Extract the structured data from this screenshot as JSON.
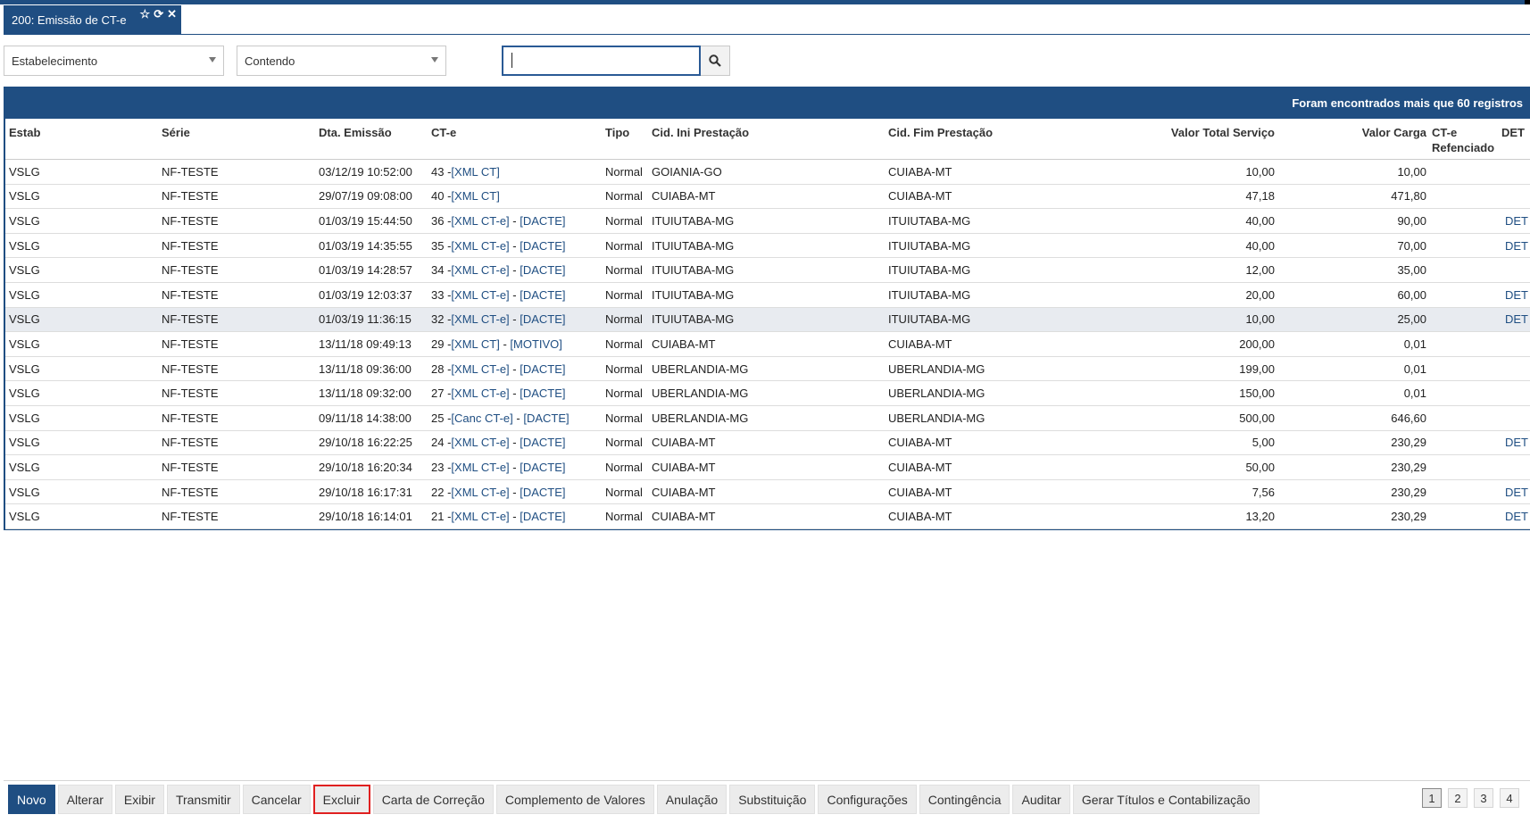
{
  "tab": {
    "title": "200: Emissão de CT-e",
    "icons": [
      "star-icon",
      "refresh-icon",
      "close-icon"
    ]
  },
  "filters": {
    "field_select": "Estabelecimento",
    "operator_select": "Contendo",
    "search_value": "",
    "search_icon": "search-icon"
  },
  "grid": {
    "banner": "Foram encontrados mais que 60 registros",
    "columns": {
      "estab": "Estab",
      "serie": "Série",
      "dta": "Dta. Emissão",
      "cte": "CT-e",
      "tipo": "Tipo",
      "ini": "Cid. Ini Prestação",
      "fim": "Cid. Fim Prestação",
      "vts": "Valor Total Serviço",
      "vc": "Valor Carga",
      "ref": "CT-e Refenciado",
      "det": "DET"
    },
    "rows": [
      {
        "estab": "VSLG",
        "serie": "NF-TESTE",
        "dta": "03/12/19 10:52:00",
        "num": "43 - ",
        "l1": "[XML CT]",
        "sep": "",
        "l2": "",
        "tipo": "Normal",
        "ini": "GOIANIA-GO",
        "fim": "CUIABA-MT",
        "vts": "10,00",
        "vc": "10,00",
        "det": ""
      },
      {
        "estab": "VSLG",
        "serie": "NF-TESTE",
        "dta": "29/07/19 09:08:00",
        "num": "40 - ",
        "l1": "[XML CT]",
        "sep": "",
        "l2": "",
        "tipo": "Normal",
        "ini": "CUIABA-MT",
        "fim": "CUIABA-MT",
        "vts": "47,18",
        "vc": "471,80",
        "det": ""
      },
      {
        "estab": "VSLG",
        "serie": "NF-TESTE",
        "dta": "01/03/19 15:44:50",
        "num": "36 - ",
        "l1": "[XML CT-e]",
        "sep": " - ",
        "l2": "[DACTE]",
        "tipo": "Normal",
        "ini": "ITUIUTABA-MG",
        "fim": "ITUIUTABA-MG",
        "vts": "40,00",
        "vc": "90,00",
        "det": "DET"
      },
      {
        "estab": "VSLG",
        "serie": "NF-TESTE",
        "dta": "01/03/19 14:35:55",
        "num": "35 - ",
        "l1": "[XML CT-e]",
        "sep": " - ",
        "l2": "[DACTE]",
        "tipo": "Normal",
        "ini": "ITUIUTABA-MG",
        "fim": "ITUIUTABA-MG",
        "vts": "40,00",
        "vc": "70,00",
        "det": "DET"
      },
      {
        "estab": "VSLG",
        "serie": "NF-TESTE",
        "dta": "01/03/19 14:28:57",
        "num": "34 - ",
        "l1": "[XML CT-e]",
        "sep": " - ",
        "l2": "[DACTE]",
        "tipo": "Normal",
        "ini": "ITUIUTABA-MG",
        "fim": "ITUIUTABA-MG",
        "vts": "12,00",
        "vc": "35,00",
        "det": ""
      },
      {
        "estab": "VSLG",
        "serie": "NF-TESTE",
        "dta": "01/03/19 12:03:37",
        "num": "33 - ",
        "l1": "[XML CT-e]",
        "sep": " - ",
        "l2": "[DACTE]",
        "tipo": "Normal",
        "ini": "ITUIUTABA-MG",
        "fim": "ITUIUTABA-MG",
        "vts": "20,00",
        "vc": "60,00",
        "det": "DET"
      },
      {
        "estab": "VSLG",
        "serie": "NF-TESTE",
        "dta": "01/03/19 11:36:15",
        "num": "32 - ",
        "l1": "[XML CT-e]",
        "sep": " - ",
        "l2": "[DACTE]",
        "tipo": "Normal",
        "ini": "ITUIUTABA-MG",
        "fim": "ITUIUTABA-MG",
        "vts": "10,00",
        "vc": "25,00",
        "det": "DET",
        "highlight": true
      },
      {
        "estab": "VSLG",
        "serie": "NF-TESTE",
        "dta": "13/11/18 09:49:13",
        "num": "29 - ",
        "l1": "[XML CT]",
        "sep": " - ",
        "l2": "[MOTIVO]",
        "tipo": "Normal",
        "ini": "CUIABA-MT",
        "fim": "CUIABA-MT",
        "vts": "200,00",
        "vc": "0,01",
        "det": ""
      },
      {
        "estab": "VSLG",
        "serie": "NF-TESTE",
        "dta": "13/11/18 09:36:00",
        "num": "28 - ",
        "l1": "[XML CT-e]",
        "sep": " - ",
        "l2": "[DACTE]",
        "tipo": "Normal",
        "ini": "UBERLANDIA-MG",
        "fim": "UBERLANDIA-MG",
        "vts": "199,00",
        "vc": "0,01",
        "det": ""
      },
      {
        "estab": "VSLG",
        "serie": "NF-TESTE",
        "dta": "13/11/18 09:32:00",
        "num": "27 - ",
        "l1": "[XML CT-e]",
        "sep": " - ",
        "l2": "[DACTE]",
        "tipo": "Normal",
        "ini": "UBERLANDIA-MG",
        "fim": "UBERLANDIA-MG",
        "vts": "150,00",
        "vc": "0,01",
        "det": ""
      },
      {
        "estab": "VSLG",
        "serie": "NF-TESTE",
        "dta": "09/11/18 14:38:00",
        "num": "25 - ",
        "l1": "[Canc CT-e]",
        "sep": " - ",
        "l2": "[DACTE]",
        "tipo": "Normal",
        "ini": "UBERLANDIA-MG",
        "fim": "UBERLANDIA-MG",
        "vts": "500,00",
        "vc": "646,60",
        "det": ""
      },
      {
        "estab": "VSLG",
        "serie": "NF-TESTE",
        "dta": "29/10/18 16:22:25",
        "num": "24 - ",
        "l1": "[XML CT-e]",
        "sep": " - ",
        "l2": "[DACTE]",
        "tipo": "Normal",
        "ini": "CUIABA-MT",
        "fim": "CUIABA-MT",
        "vts": "5,00",
        "vc": "230,29",
        "det": "DET"
      },
      {
        "estab": "VSLG",
        "serie": "NF-TESTE",
        "dta": "29/10/18 16:20:34",
        "num": "23 - ",
        "l1": "[XML CT-e]",
        "sep": " - ",
        "l2": "[DACTE]",
        "tipo": "Normal",
        "ini": "CUIABA-MT",
        "fim": "CUIABA-MT",
        "vts": "50,00",
        "vc": "230,29",
        "det": ""
      },
      {
        "estab": "VSLG",
        "serie": "NF-TESTE",
        "dta": "29/10/18 16:17:31",
        "num": "22 - ",
        "l1": "[XML CT-e]",
        "sep": " - ",
        "l2": "[DACTE]",
        "tipo": "Normal",
        "ini": "CUIABA-MT",
        "fim": "CUIABA-MT",
        "vts": "7,56",
        "vc": "230,29",
        "det": "DET"
      },
      {
        "estab": "VSLG",
        "serie": "NF-TESTE",
        "dta": "29/10/18 16:14:01",
        "num": "21 - ",
        "l1": "[XML CT-e]",
        "sep": " - ",
        "l2": "[DACTE]",
        "tipo": "Normal",
        "ini": "CUIABA-MT",
        "fim": "CUIABA-MT",
        "vts": "13,20",
        "vc": "230,29",
        "det": "DET"
      }
    ]
  },
  "toolbar": {
    "buttons": [
      {
        "label": "Novo",
        "name": "novo-button",
        "style": "primary"
      },
      {
        "label": "Alterar",
        "name": "alterar-button"
      },
      {
        "label": "Exibir",
        "name": "exibir-button"
      },
      {
        "label": "Transmitir",
        "name": "transmitir-button"
      },
      {
        "label": "Cancelar",
        "name": "cancelar-button"
      },
      {
        "label": "Excluir",
        "name": "excluir-button",
        "style": "outlined"
      },
      {
        "label": "Carta de Correção",
        "name": "carta-de-correcao-button"
      },
      {
        "label": "Complemento de Valores",
        "name": "complemento-de-valores-button"
      },
      {
        "label": "Anulação",
        "name": "anulacao-button"
      },
      {
        "label": "Substituição",
        "name": "substituicao-button"
      },
      {
        "label": "Configurações",
        "name": "configuracoes-button"
      },
      {
        "label": "Contingência",
        "name": "contingencia-button"
      },
      {
        "label": "Auditar",
        "name": "auditar-button"
      },
      {
        "label": "Gerar Títulos e Contabilização",
        "name": "gerar-titulos-button"
      }
    ]
  },
  "pager": {
    "pages": [
      "1",
      "2",
      "3",
      "4"
    ],
    "current": "1"
  },
  "colors": {
    "primary": "#1f4e82",
    "highlight_row": "#e8ebf0",
    "outline_red": "#e02020"
  }
}
